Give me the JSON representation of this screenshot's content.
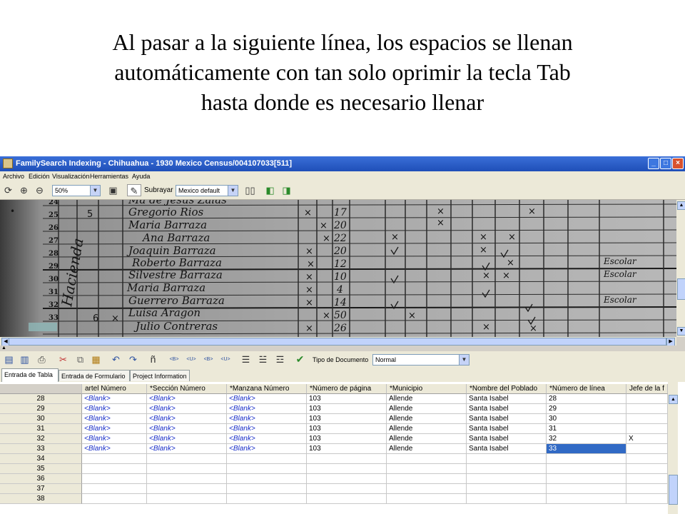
{
  "caption": {
    "line1": "Al pasar a la siguiente línea, los espacios se llenan",
    "line2": "automáticamente con tan solo oprimir la tecla Tab",
    "line3": "hasta donde es necesario llenar"
  },
  "window": {
    "title": "FamilySearch Indexing - Chihuahua - 1930 Mexico Census/004107033[511]",
    "minimize": "_",
    "maximize": "□",
    "close": "×"
  },
  "menu": [
    "Archivo",
    "Edición",
    "Visualización",
    "Herramientas",
    "Ayuda"
  ],
  "toolbar1": {
    "zoom": "50%",
    "highlight_label": "Subrayar",
    "highlight_value": "Mexico default"
  },
  "image_rows": [
    "24",
    "25",
    "26",
    "27",
    "28",
    "29",
    "30",
    "31",
    "32",
    "33"
  ],
  "image_names": [
    "Ma de Jesus Zalas",
    "Gregorio Rios",
    "Maria Barraza",
    "Ana Barraza",
    "Joaquin Barraza",
    "Roberto Barraza",
    "Silvestre Barraza",
    "Maria Barraza",
    "Guerrero Barraza",
    "Luisa Aragon",
    "Julio Contreras"
  ],
  "image_ages": [
    "17",
    "20",
    "22",
    "20",
    "12",
    "10",
    "4",
    "14",
    "50",
    "26"
  ],
  "image_annotations": [
    "Escolar",
    "Escolar",
    "Escolar"
  ],
  "toolbar2": {
    "doc_type_label": "Tipo de Documento",
    "doc_type_value": "Normal",
    "tags": [
      "<B>",
      "<U>",
      "<B>",
      "<U>"
    ]
  },
  "tabs": [
    {
      "label": "Entrada de Tabla",
      "active": true
    },
    {
      "label": "Entrada de Formulario",
      "active": false
    },
    {
      "label": "Project Information",
      "active": false
    }
  ],
  "grid": {
    "headers": [
      "artel Número",
      "*Sección Número",
      "*Manzana Número",
      "*Número de página",
      "*Municipio",
      "*Nombre del Poblado",
      "*Número de línea",
      "Jefe de la f"
    ],
    "rows": [
      {
        "num": "28",
        "cells": [
          "<Blank>",
          "<Blank>",
          "<Blank>",
          "103",
          "Allende",
          "Santa Isabel",
          "28",
          ""
        ]
      },
      {
        "num": "29",
        "cells": [
          "<Blank>",
          "<Blank>",
          "<Blank>",
          "103",
          "Allende",
          "Santa Isabel",
          "29",
          ""
        ]
      },
      {
        "num": "30",
        "cells": [
          "<Blank>",
          "<Blank>",
          "<Blank>",
          "103",
          "Allende",
          "Santa Isabel",
          "30",
          ""
        ]
      },
      {
        "num": "31",
        "cells": [
          "<Blank>",
          "<Blank>",
          "<Blank>",
          "103",
          "Allende",
          "Santa Isabel",
          "31",
          ""
        ]
      },
      {
        "num": "32",
        "cells": [
          "<Blank>",
          "<Blank>",
          "<Blank>",
          "103",
          "Allende",
          "Santa Isabel",
          "32",
          "X"
        ]
      },
      {
        "num": "33",
        "cells": [
          "<Blank>",
          "<Blank>",
          "<Blank>",
          "103",
          "Allende",
          "Santa Isabel",
          "33",
          ""
        ],
        "selected_col": 6
      },
      {
        "num": "34",
        "cells": [
          "",
          "",
          "",
          "",
          "",
          "",
          "",
          ""
        ]
      },
      {
        "num": "35",
        "cells": [
          "",
          "",
          "",
          "",
          "",
          "",
          "",
          ""
        ]
      },
      {
        "num": "36",
        "cells": [
          "",
          "",
          "",
          "",
          "",
          "",
          "",
          ""
        ]
      },
      {
        "num": "37",
        "cells": [
          "",
          "",
          "",
          "",
          "",
          "",
          "",
          ""
        ]
      },
      {
        "num": "38",
        "cells": [
          "",
          "",
          "",
          "",
          "",
          "",
          "",
          ""
        ]
      }
    ]
  }
}
